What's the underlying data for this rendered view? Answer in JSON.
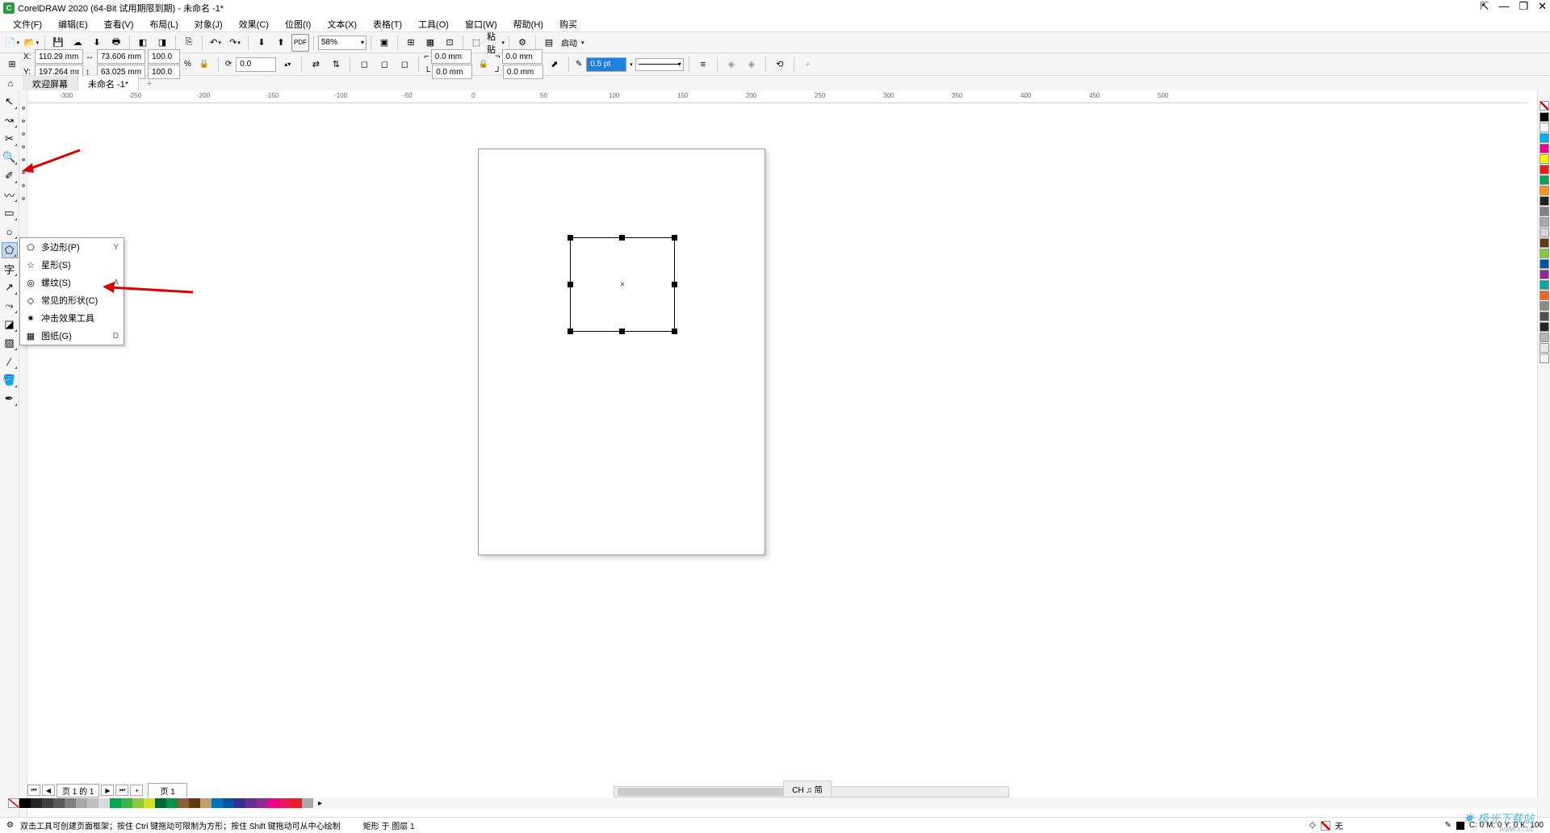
{
  "title": "CorelDRAW 2020 (64-Bit 试用期限到期) - 未命名 -1*",
  "menus": {
    "file": "文件(F)",
    "edit": "编辑(E)",
    "view": "查看(V)",
    "layout": "布局(L)",
    "object": "对象(J)",
    "effects": "效果(C)",
    "bitmaps": "位图(I)",
    "text": "文本(X)",
    "table": "表格(T)",
    "tools": "工具(O)",
    "window": "窗口(W)",
    "help": "帮助(H)",
    "buy": "购买"
  },
  "toolbar1": {
    "zoom": "58%",
    "paste": "粘贴",
    "launch": "启动"
  },
  "propbar": {
    "x": "110.29 mm",
    "y": "197.264 mm",
    "w": "73.606 mm",
    "h": "63.025 mm",
    "sx": "100.0",
    "sy": "100.0",
    "percent": "%",
    "angle": "0.0",
    "corner_tl": "0.0 mm",
    "corner_tr": "0.0 mm",
    "corner_bl": "0.0 mm",
    "corner_br": "0.0 mm",
    "outline_width": "0.5 pt"
  },
  "tabs": {
    "welcome": "欢迎屏幕",
    "doc": "未命名 -1*"
  },
  "flyout": {
    "polygon": {
      "label": "多边形(P)",
      "key": "Y"
    },
    "star": {
      "label": "星形(S)",
      "key": ""
    },
    "spiral": {
      "label": "螺纹(S)",
      "key": "A"
    },
    "common_shapes": {
      "label": "常见的形状(C)",
      "key": ""
    },
    "impact": {
      "label": "冲击效果工具",
      "key": ""
    },
    "graph_paper": {
      "label": "图纸(G)",
      "key": "D"
    }
  },
  "ruler_marks": [
    "-300",
    "-250",
    "-200",
    "-150",
    "-100",
    "-50",
    "0",
    "50",
    "100",
    "150",
    "200",
    "250",
    "300",
    "350",
    "400",
    "450",
    "500"
  ],
  "page_nav": {
    "page_indicator": "页 1 的 1",
    "page_tab": "页 1"
  },
  "doc_mode": "CH ♫ 简",
  "status": {
    "hint": "双击工具可创建页面框架；按住 Ctrl 键拖动可限制为方形；按住 Shift 键拖动可从中心绘制",
    "object": "矩形 于 图层 1",
    "fill_none": "无",
    "cmyk": "C: 0 M: 0 Y: 0 K: 100"
  },
  "right_colors": [
    "#000000",
    "#ffffff",
    "#00aeef",
    "#ec008c",
    "#fff200",
    "#ed1c24",
    "#00a651",
    "#f7941d",
    "#231f20",
    "#808285",
    "#a7a9ac",
    "#d1d3d4",
    "#603913",
    "#8dc63f",
    "#0054a6",
    "#92278f",
    "#00a99d",
    "#f26522",
    "#898989",
    "#525252",
    "#262626",
    "#b3b3b3",
    "#e6e6e6",
    "#f2f2f2"
  ],
  "bottom_colors": [
    "#000000",
    "#262626",
    "#404040",
    "#595959",
    "#808080",
    "#a6a6a6",
    "#bfbfbf",
    "#d9d9d9",
    "#00a651",
    "#39b54a",
    "#8dc63f",
    "#d7df23",
    "#006837",
    "#009444",
    "#8b5e3c",
    "#603913",
    "#c69c6d",
    "#0072bc",
    "#0054a6",
    "#2e3192",
    "#662d91",
    "#92278f",
    "#ec008c",
    "#ed145b",
    "#ed1c24",
    "#a7a9ac"
  ],
  "watermark": "极光下载站",
  "watermark_url": "www.x7.cc"
}
